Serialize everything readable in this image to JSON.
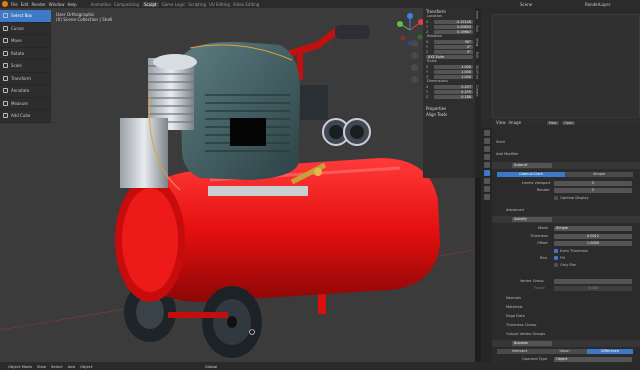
{
  "topbar": {
    "menus": [
      "File",
      "Edit",
      "Render",
      "Window",
      "Help"
    ],
    "workspaces": [
      "Animation",
      "Compositing",
      "Sculpt",
      "Game Logic",
      "Scripting",
      "UV Editing",
      "Video Editing"
    ],
    "active_workspace": "Sculpt",
    "scene": "Scene",
    "view_layer": "RenderLayer"
  },
  "toolbar": {
    "items": [
      "Select Box",
      "Cursor",
      "Move",
      "Rotate",
      "Scale",
      "Transform",
      "Annotate",
      "Measure",
      "Add Cube"
    ],
    "active": "Select Box"
  },
  "viewport": {
    "view_label": "User Orthographic",
    "collection_label": "(0) Scene Collection | Shell"
  },
  "n_panel": {
    "transform_title": "Transform",
    "location_label": "Location",
    "location": [
      {
        "axis": "X",
        "value": "-0.12148"
      },
      {
        "axis": "Y",
        "value": "0.00855"
      },
      {
        "axis": "Z",
        "value": "0.19667"
      }
    ],
    "rotation_label": "Rotation",
    "rotation": [
      {
        "axis": "X",
        "value": "90°"
      },
      {
        "axis": "Y",
        "value": "0°"
      },
      {
        "axis": "Z",
        "value": "0°"
      }
    ],
    "rotation_mode": "XYZ Euler",
    "scale_label": "Scale",
    "scale": [
      {
        "axis": "X",
        "value": "1.000"
      },
      {
        "axis": "Y",
        "value": "1.000"
      },
      {
        "axis": "Z",
        "value": "1.000"
      }
    ],
    "dimensions_label": "Dimensions",
    "dimensions": [
      {
        "axis": "X",
        "value": "0.297"
      },
      {
        "axis": "Y",
        "value": "0.259"
      },
      {
        "axis": "Z",
        "value": "0.188"
      }
    ],
    "properties": "Properties",
    "align_tools": "Align Tools",
    "tabs": [
      "Item",
      "Tool",
      "View",
      "Edit",
      "3D-Print",
      "Create"
    ]
  },
  "footer": {
    "mode": "Object Mode",
    "menus": [
      "View",
      "Select",
      "Add",
      "Object"
    ],
    "transform": "Global"
  },
  "image_editor": {
    "menus": [
      "View",
      "Image"
    ],
    "new_button": "New",
    "open_button": "Open"
  },
  "modifiers": {
    "object_name": "Shell",
    "add_modifier": "Add Modifier",
    "subsurf": {
      "name": "Subsurf",
      "algo_catmull": "Catmull-Clark",
      "algo_simple": "Simple",
      "levels_viewport_label": "Levels Viewport",
      "levels_viewport": "2",
      "render_label": "Render",
      "render": "2",
      "optimal_display": "Optimal Display",
      "advanced": "Advanced"
    },
    "solidify": {
      "name": "Solidify",
      "mode_label": "Mode",
      "mode": "Simple",
      "thickness_label": "Thickness",
      "thickness": "0.0012",
      "offset_label": "Offset",
      "offset": "1.0000",
      "even_thickness": "Even Thickness",
      "rim_label": "Rim",
      "fill": "Fill",
      "only_rim": "Only Rim",
      "vertex_group_label": "Vertex Group",
      "factor_label": "Factor",
      "factor": "0.000",
      "sections": [
        "Normals",
        "Materials",
        "Edge Data",
        "Thickness Clamp",
        "Output Vertex Groups"
      ]
    },
    "boolean": {
      "name": "Boolean",
      "ops": [
        "Intersect",
        "Union",
        "Difference"
      ],
      "active_op": "Difference",
      "operand_type_label": "Operand Type",
      "operand_type": "Object",
      "object_label": "Object"
    }
  },
  "colors": {
    "accent": "#3c7ac7",
    "tank_red": "#e60f0f",
    "motor_teal": "#3d5c62",
    "logo": "#e87d0d"
  }
}
